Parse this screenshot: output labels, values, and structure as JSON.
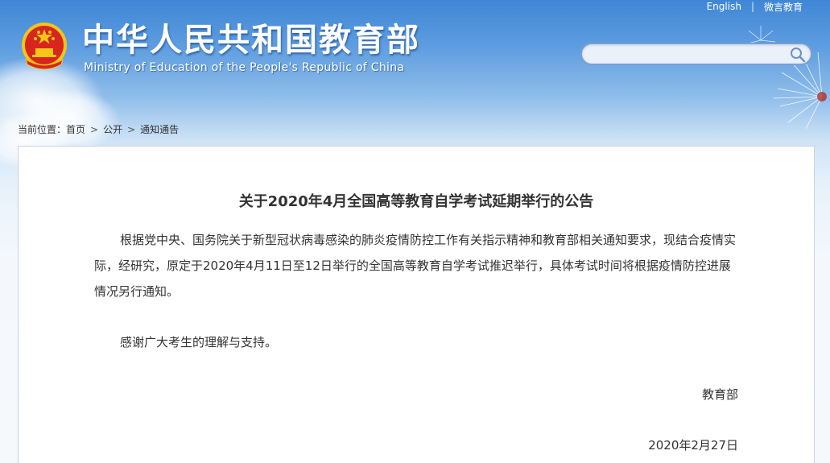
{
  "header": {
    "title_cn": "中华人民共和国教育部",
    "title_en": "Ministry of Education of the People's Republic of China",
    "logo_icon": "national-emblem-icon"
  },
  "topnav": {
    "english_label": "English",
    "separator": "|",
    "weibo_label": "微言教育"
  },
  "search": {
    "placeholder": "",
    "value": "",
    "icon": "search-icon"
  },
  "breadcrumb": {
    "prefix": "当前位置：",
    "items": [
      "首页",
      "公开",
      "通知通告"
    ],
    "separator": ">"
  },
  "article": {
    "title": "关于2020年4月全国高等教育自学考试延期举行的公告",
    "paragraph1": "根据党中央、国务院关于新型冠状病毒感染的肺炎疫情防控工作有关指示精神和教育部相关通知要求，现结合疫情实际，经研究，原定于2020年4月11日至12日举行的全国高等教育自学考试推迟举行，具体考试时间将根据疫情防控进展情况另行通知。",
    "paragraph2": "感谢广大考生的理解与支持。",
    "signature": "教育部",
    "date": "2020年2月27日"
  },
  "colors": {
    "header_blue": "#3f86d6",
    "title_text": "#333333",
    "emblem_red": "#d7261e",
    "emblem_gold": "#f5c518"
  }
}
